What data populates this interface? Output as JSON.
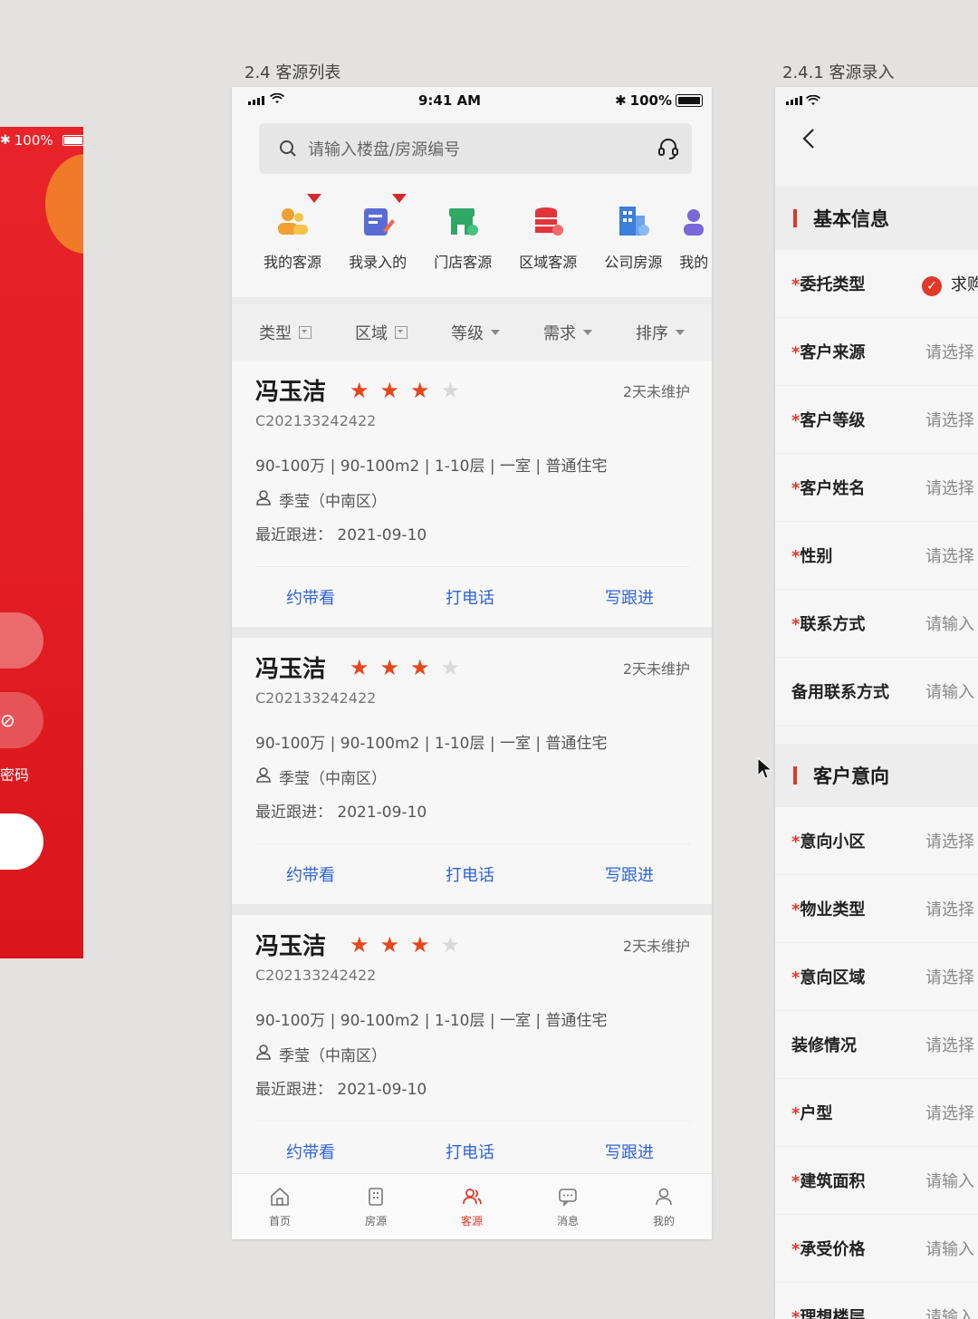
{
  "left_board": {
    "battery_text": "100%",
    "password_label": "密码"
  },
  "labels": {
    "list_board": "2.4 客源列表",
    "form_board": "2.4.1 客源录入"
  },
  "phone": {
    "status": {
      "time": "9:41 AM",
      "battery": "100%"
    },
    "search": {
      "placeholder": "请输入楼盘/房源编号"
    },
    "quick_items": [
      {
        "label": "我的客源",
        "icon": "my-clients-icon",
        "color": "#f0a030",
        "badge": true
      },
      {
        "label": "我录入的",
        "icon": "my-entries-icon",
        "color": "#5b6bd6",
        "badge": true
      },
      {
        "label": "门店客源",
        "icon": "store-clients-icon",
        "color": "#2fa866",
        "badge": false
      },
      {
        "label": "区域客源",
        "icon": "region-clients-icon",
        "color": "#e2343b",
        "badge": false
      },
      {
        "label": "公司房源",
        "icon": "company-listings-icon",
        "color": "#3b7fd9",
        "badge": false
      },
      {
        "label": "我的",
        "icon": "more-icon",
        "color": "#7b68d8",
        "badge": false
      }
    ],
    "filters": [
      {
        "label": "类型",
        "kind": "box"
      },
      {
        "label": "区域",
        "kind": "box"
      },
      {
        "label": "等级",
        "kind": "caret"
      },
      {
        "label": "需求",
        "kind": "caret"
      },
      {
        "label": "排序",
        "kind": "caret"
      }
    ],
    "cards": [
      {
        "name": "冯玉洁",
        "stars": 3,
        "max_stars": 4,
        "maintenance": "2天未维护",
        "code": "C202133242422",
        "desc": "90-100万 | 90-100m2 | 1-10层 | 一室 | 普通住宅",
        "person": "季莹（中南区）",
        "follow": "最近跟进：  2021-09-10",
        "actions": [
          "约带看",
          "打电话",
          "写跟进"
        ]
      },
      {
        "name": "冯玉洁",
        "stars": 3,
        "max_stars": 4,
        "maintenance": "2天未维护",
        "code": "C202133242422",
        "desc": "90-100万 | 90-100m2 | 1-10层 | 一室 | 普通住宅",
        "person": "季莹（中南区）",
        "follow": "最近跟进：  2021-09-10",
        "actions": [
          "约带看",
          "打电话",
          "写跟进"
        ]
      },
      {
        "name": "冯玉洁",
        "stars": 3,
        "max_stars": 4,
        "maintenance": "2天未维护",
        "code": "C202133242422",
        "desc": "90-100万 | 90-100m2 | 1-10层 | 一室 | 普通住宅",
        "person": "季莹（中南区）",
        "follow": "最近跟进：  2021-09-10",
        "actions": [
          "约带看",
          "打电话",
          "写跟进"
        ]
      }
    ],
    "tabs": [
      {
        "label": "首页",
        "icon": "home-icon",
        "active": false
      },
      {
        "label": "房源",
        "icon": "building-icon",
        "active": false
      },
      {
        "label": "客源",
        "icon": "clients-icon",
        "active": true
      },
      {
        "label": "消息",
        "icon": "message-icon",
        "active": false
      },
      {
        "label": "我的",
        "icon": "profile-icon",
        "active": false
      }
    ]
  },
  "form": {
    "sections": [
      {
        "title": "基本信息",
        "rows": [
          {
            "label": "委托类型",
            "required": true,
            "value": "求购",
            "checked": true
          },
          {
            "label": "客户来源",
            "required": true,
            "value": "请选择"
          },
          {
            "label": "客户等级",
            "required": true,
            "value": "请选择"
          },
          {
            "label": "客户姓名",
            "required": true,
            "value": "请选择"
          },
          {
            "label": "性别",
            "required": true,
            "value": "请选择"
          },
          {
            "label": "联系方式",
            "required": true,
            "value": "请输入"
          },
          {
            "label": "备用联系方式",
            "required": false,
            "value": "请输入"
          }
        ]
      },
      {
        "title": "客户意向",
        "rows": [
          {
            "label": "意向小区",
            "required": true,
            "value": "请选择"
          },
          {
            "label": "物业类型",
            "required": true,
            "value": "请选择"
          },
          {
            "label": "意向区域",
            "required": true,
            "value": "请选择"
          },
          {
            "label": "装修情况",
            "required": false,
            "value": "请选择"
          },
          {
            "label": "户型",
            "required": true,
            "value": "请选择"
          },
          {
            "label": "建筑面积",
            "required": true,
            "value": "请输入"
          },
          {
            "label": "承受价格",
            "required": true,
            "value": "请输入"
          },
          {
            "label": "理想楼层",
            "required": true,
            "value": "请输入"
          }
        ]
      }
    ]
  }
}
